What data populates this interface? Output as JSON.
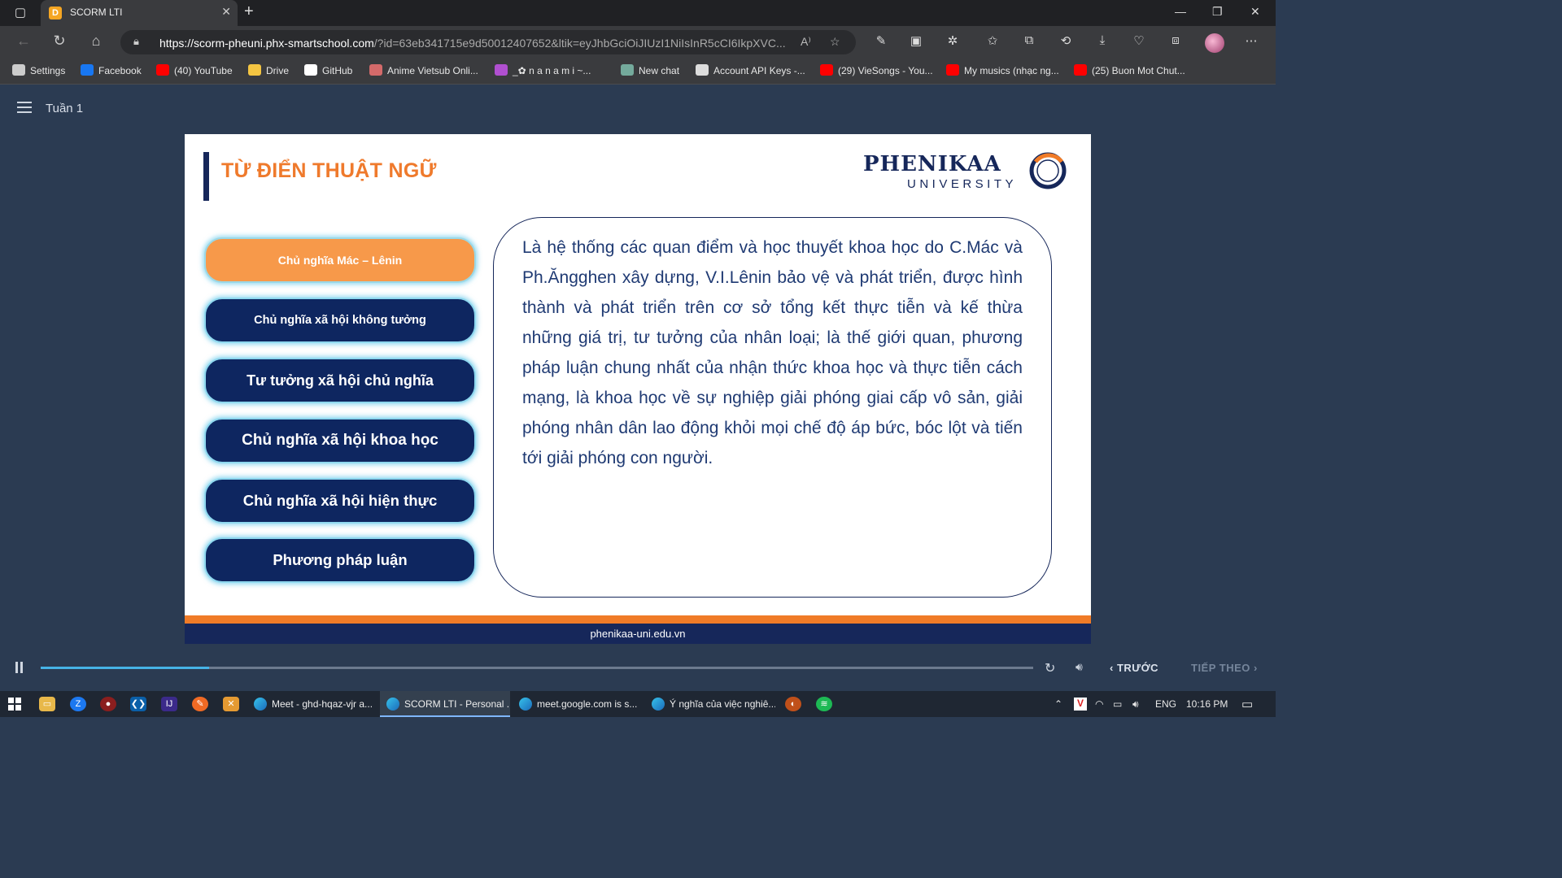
{
  "browser": {
    "tab_title": "SCORM LTI",
    "tab_favicon": "D",
    "url_domain": "https://scorm-pheuni.phx-smartschool.com",
    "url_rest": "/?id=63eb341715e9d50012407652&ltik=eyJhbGciOiJIUzI1NiIsInR5cCI6IkpXVC...",
    "bookmarks": [
      {
        "label": "Settings",
        "icon": "gear-icon",
        "color": "#cccccc"
      },
      {
        "label": "Facebook",
        "icon": "facebook-icon",
        "color": "#1877f2"
      },
      {
        "label": "(40) YouTube",
        "icon": "youtube-icon",
        "color": "#ff0000"
      },
      {
        "label": "Drive",
        "icon": "folder-icon",
        "color": "#f4c542"
      },
      {
        "label": "GitHub",
        "icon": "github-icon",
        "color": "#ffffff"
      },
      {
        "label": "Anime Vietsub Onli...",
        "icon": "anime-icon",
        "color": "#d46a6a"
      },
      {
        "label": "_✿ n a n a m i ~...",
        "icon": "nanami-icon",
        "color": "#b04fd0"
      },
      {
        "label": "New chat",
        "icon": "chatgpt-icon",
        "color": "#74aa9c"
      },
      {
        "label": "Account API Keys -...",
        "icon": "openai-icon",
        "color": "#dddddd"
      },
      {
        "label": "(29) VieSongs - You...",
        "icon": "youtube-icon",
        "color": "#ff0000"
      },
      {
        "label": "My musics (nhạc ng...",
        "icon": "youtube-icon",
        "color": "#ff0000"
      },
      {
        "label": "(25) Buon Mot Chut...",
        "icon": "youtube-icon",
        "color": "#ff0000"
      }
    ]
  },
  "app": {
    "week_label": "Tuần 1"
  },
  "slide": {
    "title": "TỪ ĐIỂN THUẬT NGỮ",
    "logo_main": "PHENIKAA",
    "logo_sub": "UNIVERSITY",
    "terms": [
      {
        "label": "Chủ nghĩa Mác – Lênin",
        "active": true
      },
      {
        "label": "Chủ nghĩa xã hội không tưởng",
        "active": false
      },
      {
        "label": "Tư tưởng xã hội chủ nghĩa",
        "active": false
      },
      {
        "label": "Chủ nghĩa xã hội khoa học",
        "active": false
      },
      {
        "label": "Chủ nghĩa xã hội hiện thực",
        "active": false
      },
      {
        "label": "Phương pháp luận",
        "active": false
      }
    ],
    "definition": "Là hệ thống các quan điểm và học thuyết khoa học do C.Mác và Ph.Ăngghen xây dựng, V.I.Lênin bảo vệ và phát triển, được hình thành và phát triển trên cơ sở tổng kết thực tiễn và kế thừa những giá trị, tư tưởng của nhân loại; là thế giới quan, phương pháp luận chung nhất của nhận thức khoa học và thực tiễn cách mạng, là khoa học về sự nghiệp giải phóng giai cấp vô sản, giải phóng nhân dân lao động khỏi mọi chế độ áp bức, bóc lột và tiến tới giải phóng con người.",
    "footer_url": "phenikaa-uni.edu.vn",
    "colors": {
      "accent": "#ef7a2c",
      "navy": "#16275a",
      "active_term": "#f7994a"
    }
  },
  "player": {
    "progress_fraction": 0.17,
    "prev_label": "TRƯỚC",
    "next_label": "TIẾP THEO"
  },
  "taskbar": {
    "windows": [
      {
        "label": "Meet - ghd-hqaz-vjr a...",
        "active": false
      },
      {
        "label": "SCORM LTI - Personal ...",
        "active": true
      },
      {
        "label": "meet.google.com is s...",
        "active": false
      },
      {
        "label": "Ý nghĩa của việc nghiê...",
        "active": false
      }
    ],
    "lang": "ENG",
    "time": "10:16 PM"
  }
}
